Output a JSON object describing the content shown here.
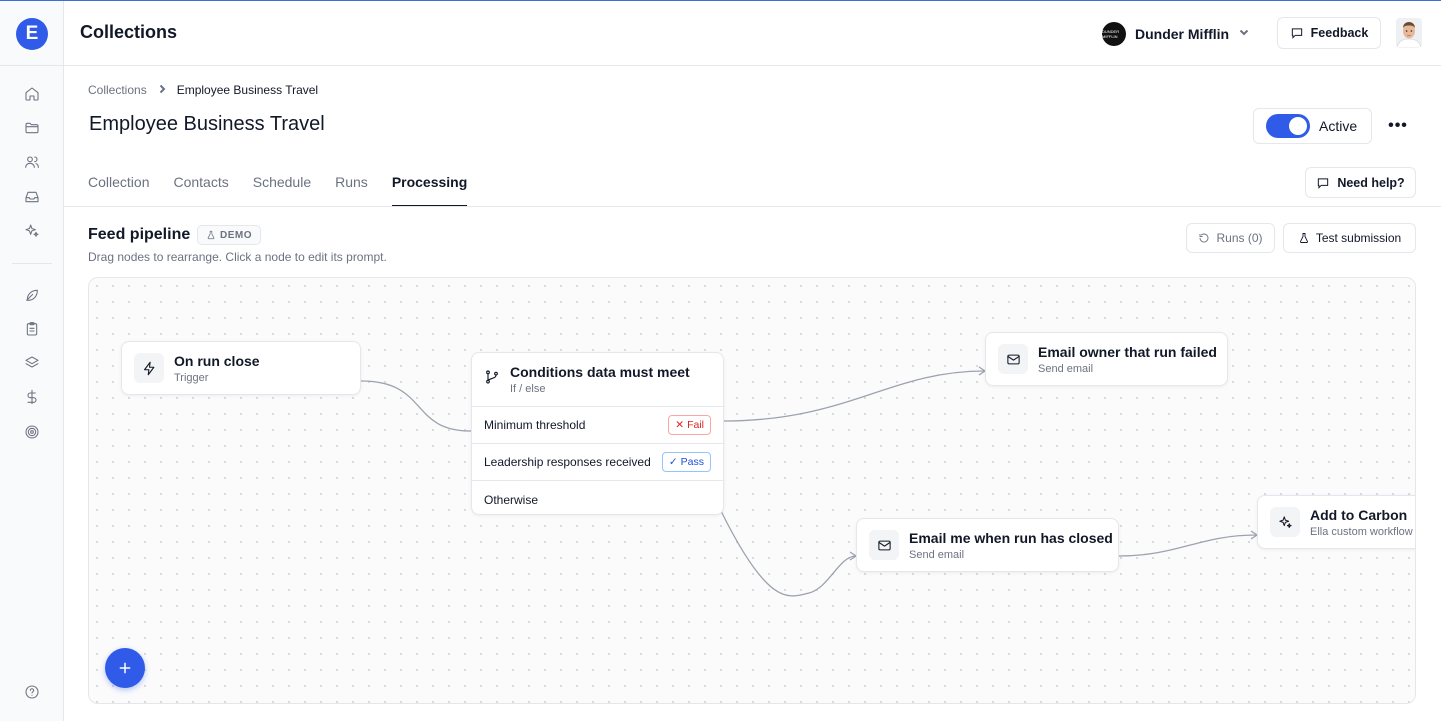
{
  "app": {
    "logo_letter": "E",
    "title": "Collections"
  },
  "org": {
    "name": "Dunder Mifflin",
    "logo_text": "DUNDER MIFFLIN"
  },
  "header": {
    "feedback_label": "Feedback"
  },
  "sidebar": {
    "items": [
      {
        "icon": "home-icon"
      },
      {
        "icon": "folder-icon"
      },
      {
        "icon": "users-icon"
      },
      {
        "icon": "inbox-icon"
      },
      {
        "icon": "sparkles-icon"
      },
      {
        "icon": "leaf-icon"
      },
      {
        "icon": "clipboard-icon"
      },
      {
        "icon": "layers-icon"
      },
      {
        "icon": "dollar-icon"
      },
      {
        "icon": "target-icon"
      },
      {
        "icon": "help-icon"
      }
    ]
  },
  "breadcrumb": {
    "parent": "Collections",
    "current": "Employee Business Travel"
  },
  "page": {
    "title": "Employee Business Travel",
    "active_label": "Active",
    "active_on": true
  },
  "tabs": [
    {
      "label": "Collection",
      "active": false
    },
    {
      "label": "Contacts",
      "active": false
    },
    {
      "label": "Schedule",
      "active": false
    },
    {
      "label": "Runs",
      "active": false
    },
    {
      "label": "Processing",
      "active": true
    }
  ],
  "help_label": "Need help?",
  "pipeline": {
    "title": "Feed pipeline",
    "badge": "DEMO",
    "subtitle": "Drag nodes to rearrange. Click a node to edit its prompt.",
    "runs_label": "Runs (0)",
    "test_label": "Test submission"
  },
  "nodes": {
    "trigger": {
      "title": "On run close",
      "subtitle": "Trigger"
    },
    "condition": {
      "title": "Conditions data must meet",
      "subtitle": "If / else",
      "rows": [
        {
          "label": "Minimum threshold",
          "badge": "Fail"
        },
        {
          "label": "Leadership responses received",
          "badge": "Pass"
        },
        {
          "label": "Otherwise",
          "badge": ""
        }
      ]
    },
    "email_failed": {
      "title": "Email owner that run failed",
      "subtitle": "Send email"
    },
    "email_closed": {
      "title": "Email me when run has closed",
      "subtitle": "Send email"
    },
    "carbon": {
      "title": "Add to Carbon",
      "subtitle": "Ella custom workflow"
    }
  },
  "colors": {
    "accent": "#2f5be8",
    "fail": "#dc2626",
    "pass": "#1d4ed8"
  }
}
